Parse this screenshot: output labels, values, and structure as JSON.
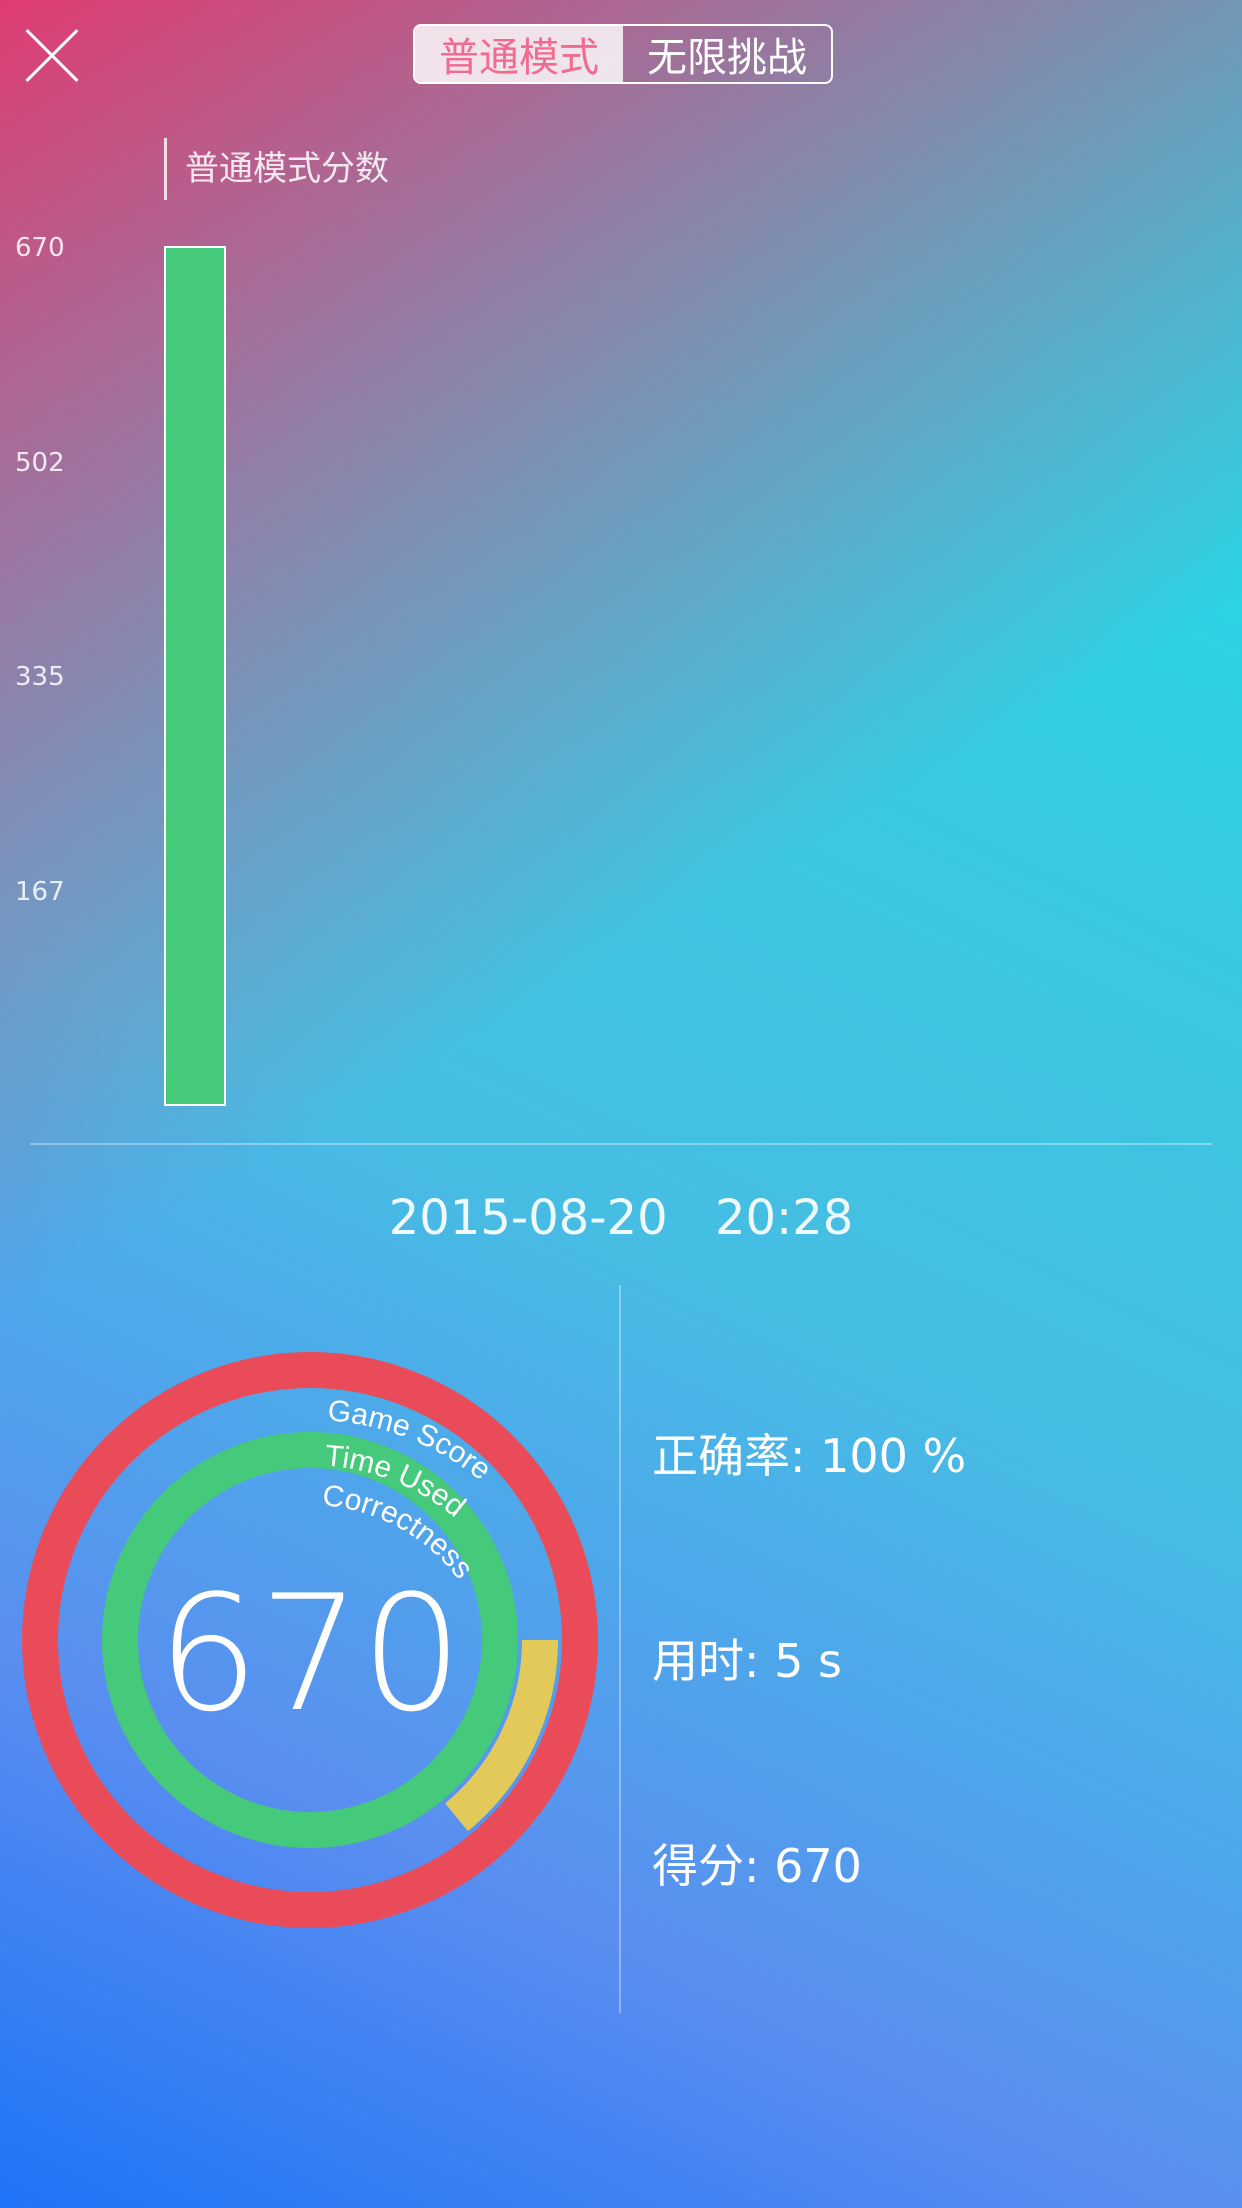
{
  "header": {
    "close_icon": "close-icon",
    "tabs": [
      {
        "label": "普通模式",
        "active": true
      },
      {
        "label": "无限挑战",
        "active": false
      }
    ]
  },
  "chart_data": {
    "type": "bar",
    "title": "普通模式分数",
    "categories": [
      ""
    ],
    "values": [
      670
    ],
    "yticks": [
      "670",
      "502",
      "335",
      "167"
    ],
    "ylim": [
      0,
      670
    ],
    "bar_color": "#45c97a"
  },
  "record": {
    "date": "2015-08-20",
    "time": "20:28"
  },
  "ring_chart": {
    "score_display": "670",
    "labels": {
      "game_score": "Game Score",
      "time_used": "Time Used",
      "correctness": "Correctness"
    },
    "colors": {
      "game_score": "#e94c58",
      "time_used": "#e2c95a",
      "correctness": "#45c97a"
    },
    "game_score_fraction": 1.0,
    "time_used_fraction": 0.14,
    "correctness_fraction": 1.0
  },
  "stats": {
    "accuracy": "正确率: 100 %",
    "time": "用时: 5 s",
    "score": "得分: 670"
  }
}
